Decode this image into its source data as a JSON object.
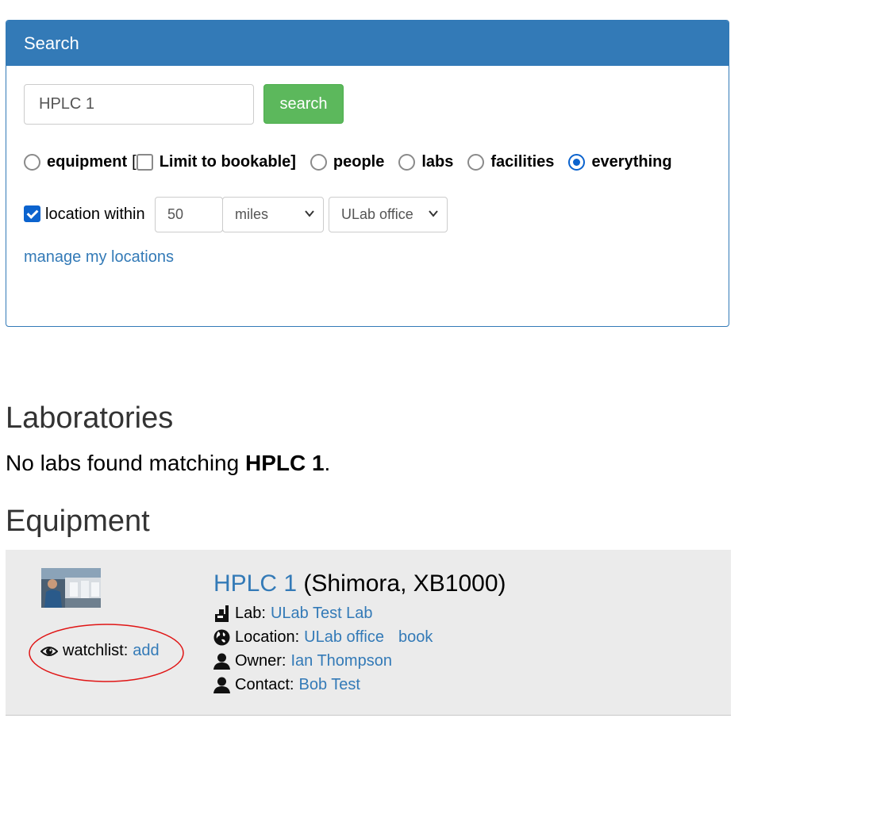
{
  "search": {
    "heading": "Search",
    "query": "HPLC 1",
    "button_label": "search",
    "options": {
      "equipment": "equipment",
      "bracket_open": "[",
      "limit_bookable": "Limit to bookable]",
      "people": "people",
      "labs": "labs",
      "facilities": "facilities",
      "everything": "everything",
      "selected": "everything",
      "limit_bookable_checked": false
    },
    "location": {
      "checked": true,
      "label": "location within",
      "distance": "50",
      "unit": "miles",
      "place": "ULab office"
    },
    "manage_link": "manage my locations"
  },
  "labs": {
    "heading": "Laboratories",
    "none_prefix": "No labs found matching ",
    "term": "HPLC 1",
    "suffix": "."
  },
  "equipment": {
    "heading": "Equipment",
    "items": [
      {
        "name": "HPLC 1",
        "detail": "(Shimora, XB1000)",
        "watchlist_label": "watchlist:",
        "watchlist_action": "add",
        "lab_label": "Lab:",
        "lab": "ULab Test Lab",
        "location_label": "Location:",
        "location": "ULab office",
        "book": "book",
        "owner_label": "Owner:",
        "owner": "Ian Thompson",
        "contact_label": "Contact:",
        "contact": "Bob Test"
      }
    ]
  },
  "colors": {
    "primary": "#337ab7",
    "success": "#5cb85c",
    "annotation": "#e01515",
    "row_bg": "#ebebeb"
  }
}
